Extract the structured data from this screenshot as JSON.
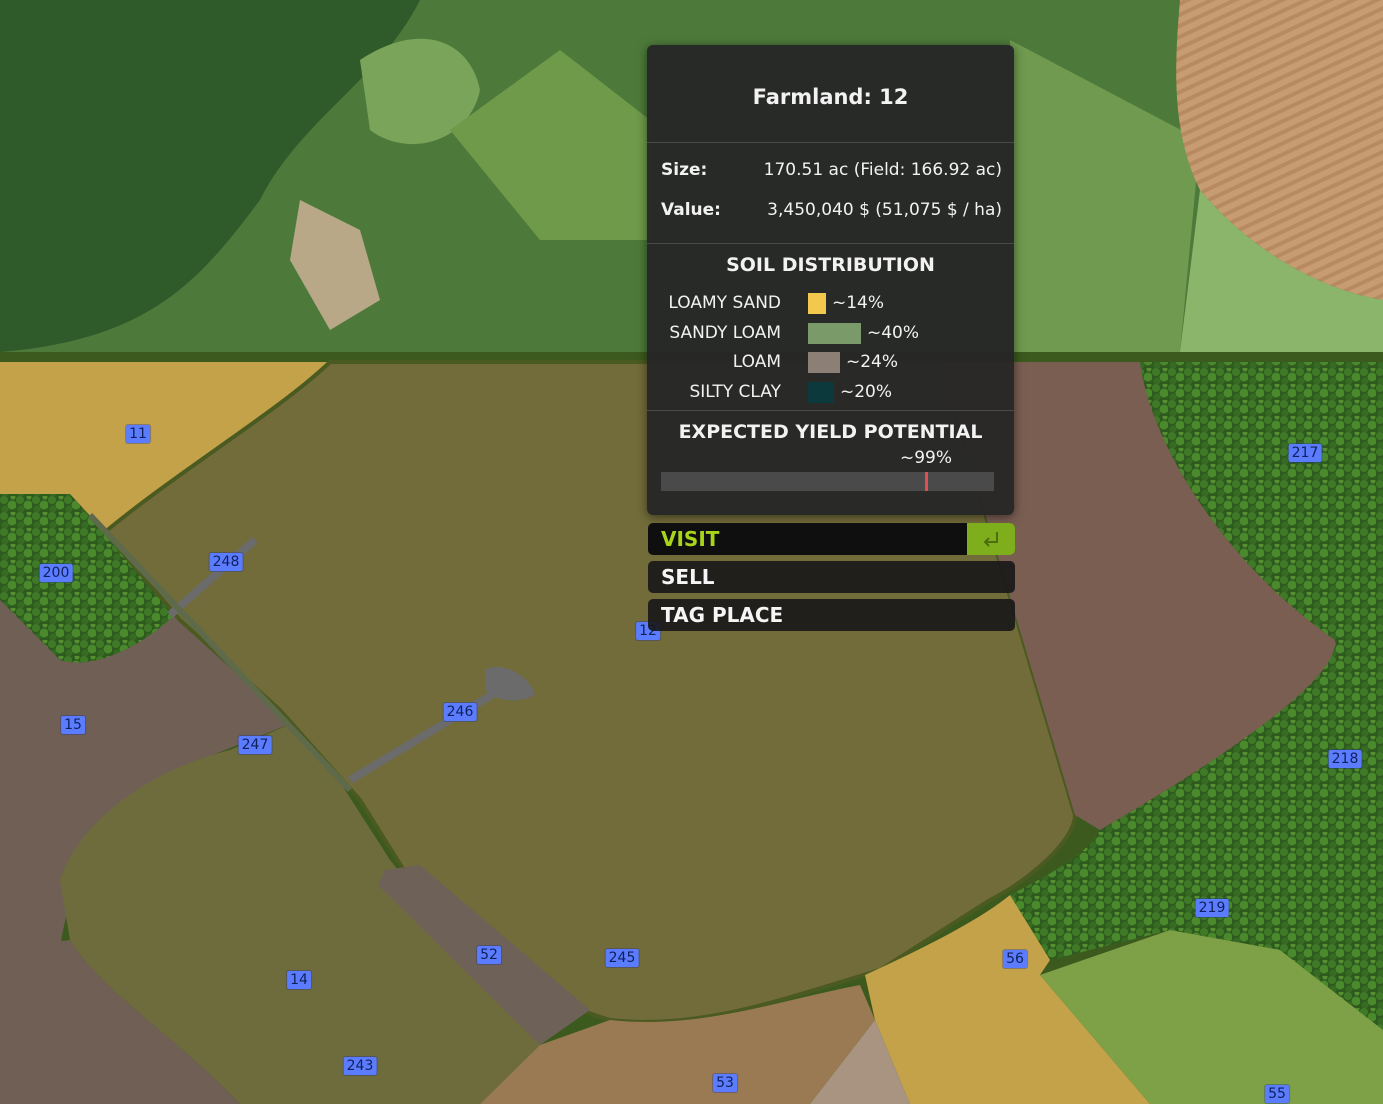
{
  "panel": {
    "title": "Farmland: 12",
    "size_label": "Size:",
    "size_value": "170.51 ac (Field: 166.92 ac)",
    "value_label": "Value:",
    "value_value": "3,450,040 $ (51,075 $ / ha)",
    "soil_heading": "SOIL DISTRIBUTION",
    "soils": [
      {
        "name": "LOAMY SAND",
        "pct": "~14%",
        "fraction": 0.14,
        "color": "#f2c94c"
      },
      {
        "name": "SANDY LOAM",
        "pct": "~40%",
        "fraction": 0.4,
        "color": "#7b9a6a"
      },
      {
        "name": "LOAM",
        "pct": "~24%",
        "fraction": 0.24,
        "color": "#8c7f76"
      },
      {
        "name": "SILTY CLAY",
        "pct": "~20%",
        "fraction": 0.2,
        "color": "#0c3a3c"
      }
    ],
    "yield_heading": "EXPECTED YIELD POTENTIAL",
    "yield_pct": "~99%",
    "yield_fraction": 0.99
  },
  "actions": {
    "visit": "VISIT",
    "sell": "SELL",
    "tag_place": "TAG PLACE",
    "enter_icon": "enter-return-icon"
  },
  "fields": [
    "11",
    "200",
    "248",
    "15",
    "247",
    "246",
    "12",
    "14",
    "243",
    "52",
    "245",
    "53",
    "56",
    "55",
    "217",
    "218",
    "219"
  ],
  "colors": {
    "accent": "#a8d41a",
    "enter_button": "#7fae1c",
    "label_bg": "#5b7cff",
    "selected_field": "#726c3a"
  }
}
